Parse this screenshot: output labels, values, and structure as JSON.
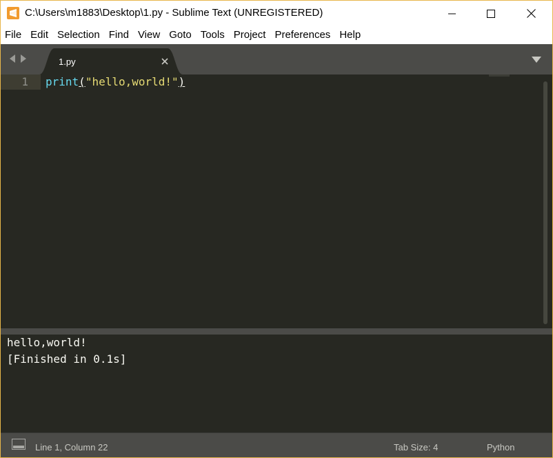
{
  "window": {
    "title": "C:\\Users\\m1883\\Desktop\\1.py - Sublime Text (UNREGISTERED)"
  },
  "menu": {
    "items": [
      "File",
      "Edit",
      "Selection",
      "Find",
      "View",
      "Goto",
      "Tools",
      "Project",
      "Preferences",
      "Help"
    ]
  },
  "tabs": [
    {
      "label": "1.py",
      "active": true
    }
  ],
  "editor": {
    "line_number": "1",
    "code": {
      "func": "print",
      "open_paren": "(",
      "string": "\"hello,world!\"",
      "close_paren": ")"
    }
  },
  "output": {
    "lines": [
      "hello,world!",
      "[Finished in 0.1s]"
    ]
  },
  "status": {
    "position": "Line 1, Column 22",
    "tab_size": "Tab Size: 4",
    "syntax": "Python"
  },
  "colors": {
    "editor_bg": "#272822",
    "chrome_bg": "#4b4b48",
    "func": "#66d9ef",
    "string": "#e6db74",
    "text": "#f8f8f2",
    "app_icon": "#f19b2f"
  },
  "icons": {
    "app": "sublime-text-icon",
    "minimize": "minimize-icon",
    "maximize": "maximize-icon",
    "close": "close-icon",
    "nav_back": "chevron-left-icon",
    "nav_forward": "chevron-right-icon",
    "tab_close": "close-icon",
    "tab_menu": "triangle-down-icon",
    "panel": "panel-toggle-icon"
  }
}
